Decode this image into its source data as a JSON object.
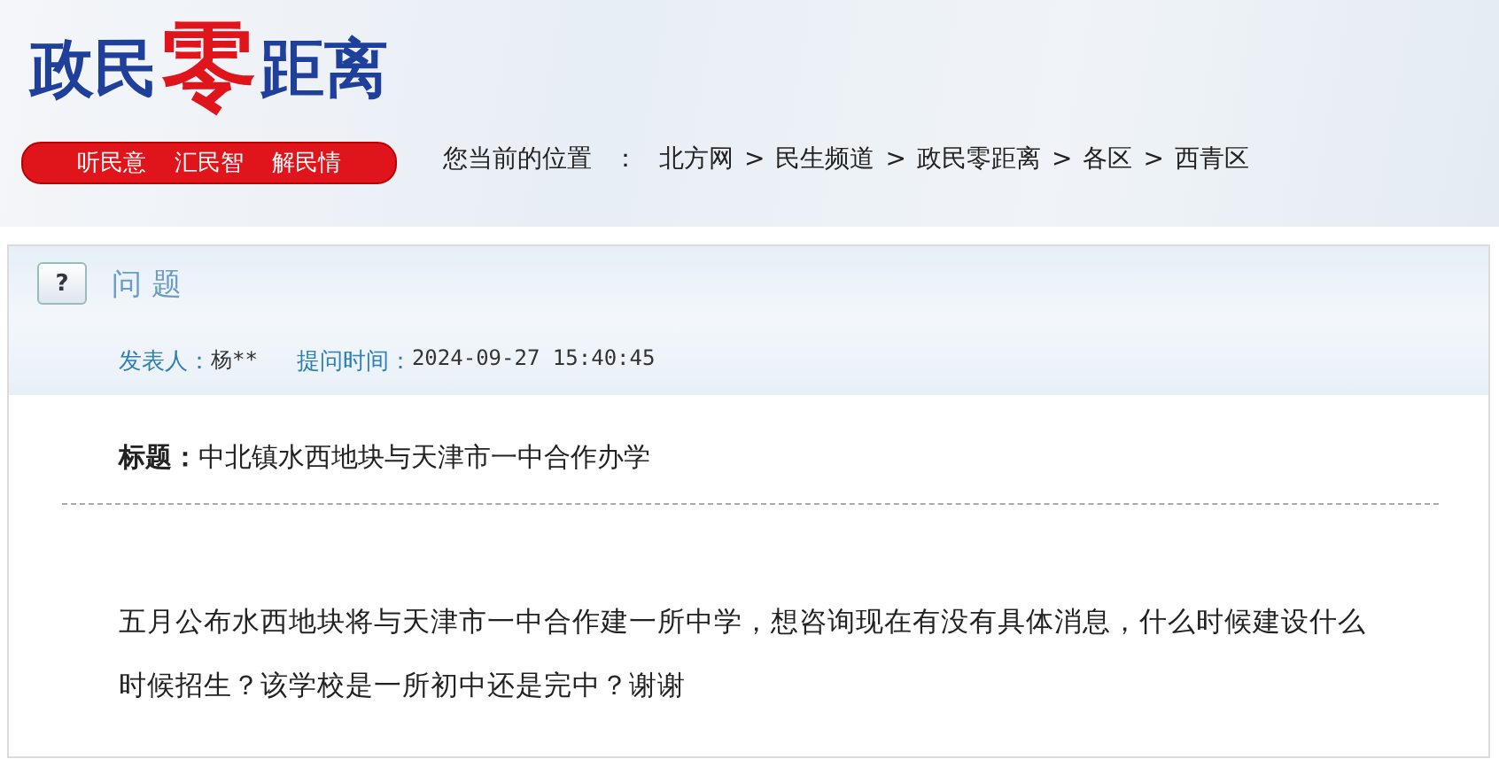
{
  "logo": {
    "parts": [
      {
        "text": "政民",
        "accent": false
      },
      {
        "text": "零",
        "accent": true
      },
      {
        "text": "距离",
        "accent": false
      }
    ],
    "slogans": [
      "听民意",
      "汇民智",
      "解民情"
    ]
  },
  "breadcrumb": {
    "label": "您当前的位置",
    "colon": "：",
    "separator": ">",
    "items": [
      "北方网",
      "民生频道",
      "政民零距离",
      "各区",
      "西青区"
    ]
  },
  "question": {
    "icon": "?",
    "heading": "问 题",
    "author_label": "发表人：",
    "author": "杨**",
    "time_label": "提问时间：",
    "time": "2024-09-27 15:40:45",
    "title_label": "标题：",
    "title": "中北镇水西地块与天津市一中合作办学",
    "body": "五月公布水西地块将与天津市一中合作建一所中学，想咨询现在有没有具体消息，什么时候建设什么时候招生？该学校是一所初中还是完中？谢谢"
  }
}
